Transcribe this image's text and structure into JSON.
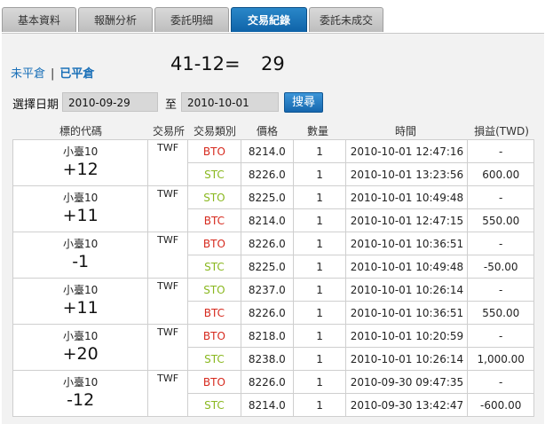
{
  "tabs": [
    {
      "label": "基本資料",
      "active": false
    },
    {
      "label": "報酬分析",
      "active": false
    },
    {
      "label": "委託明細",
      "active": false
    },
    {
      "label": "交易紀錄",
      "active": true
    },
    {
      "label": "委託未成交",
      "active": false
    }
  ],
  "filter": {
    "open_label": "未平倉",
    "separator": "|",
    "closed_label": "已平倉"
  },
  "summary": {
    "formula": "41-12=",
    "result": "29"
  },
  "date_filter": {
    "label": "選擇日期",
    "from": "2010-09-29",
    "to_label": "至",
    "to": "2010-10-01",
    "search_label": "搜尋"
  },
  "columns": [
    "標的代碼",
    "交易所",
    "交易類別",
    "價格",
    "數量",
    "時間",
    "損益(TWD)"
  ],
  "groups": [
    {
      "symbol": "小臺10",
      "net": "+12",
      "exchange": "TWF",
      "rows": [
        {
          "type": "BTO",
          "price": "8214.0",
          "qty": "1",
          "time": "2010-10-01 12:47:16",
          "pl": "-"
        },
        {
          "type": "STC",
          "price": "8226.0",
          "qty": "1",
          "time": "2010-10-01 13:23:56",
          "pl": "600.00"
        }
      ]
    },
    {
      "symbol": "小臺10",
      "net": "+11",
      "exchange": "TWF",
      "rows": [
        {
          "type": "STO",
          "price": "8225.0",
          "qty": "1",
          "time": "2010-10-01 10:49:48",
          "pl": "-"
        },
        {
          "type": "BTC",
          "price": "8214.0",
          "qty": "1",
          "time": "2010-10-01 12:47:15",
          "pl": "550.00"
        }
      ]
    },
    {
      "symbol": "小臺10",
      "net": "-1",
      "exchange": "TWF",
      "rows": [
        {
          "type": "BTO",
          "price": "8226.0",
          "qty": "1",
          "time": "2010-10-01 10:36:51",
          "pl": "-"
        },
        {
          "type": "STC",
          "price": "8225.0",
          "qty": "1",
          "time": "2010-10-01 10:49:48",
          "pl": "-50.00"
        }
      ]
    },
    {
      "symbol": "小臺10",
      "net": "+11",
      "exchange": "TWF",
      "rows": [
        {
          "type": "STO",
          "price": "8237.0",
          "qty": "1",
          "time": "2010-10-01 10:26:14",
          "pl": "-"
        },
        {
          "type": "BTC",
          "price": "8226.0",
          "qty": "1",
          "time": "2010-10-01 10:36:51",
          "pl": "550.00"
        }
      ]
    },
    {
      "symbol": "小臺10",
      "net": "+20",
      "exchange": "TWF",
      "rows": [
        {
          "type": "BTO",
          "price": "8218.0",
          "qty": "1",
          "time": "2010-10-01 10:20:59",
          "pl": "-"
        },
        {
          "type": "STC",
          "price": "8238.0",
          "qty": "1",
          "time": "2010-10-01 10:26:14",
          "pl": "1,000.00"
        }
      ]
    },
    {
      "symbol": "小臺10",
      "net": "-12",
      "exchange": "TWF",
      "rows": [
        {
          "type": "BTO",
          "price": "8226.0",
          "qty": "1",
          "time": "2010-09-30 09:47:35",
          "pl": "-"
        },
        {
          "type": "STC",
          "price": "8214.0",
          "qty": "1",
          "time": "2010-09-30 13:42:47",
          "pl": "-600.00"
        }
      ]
    }
  ],
  "colors": {
    "tab_active": "#1a70b8",
    "buy": "#d62a1e",
    "sell": "#8ab820",
    "link": "#1a70b8"
  }
}
